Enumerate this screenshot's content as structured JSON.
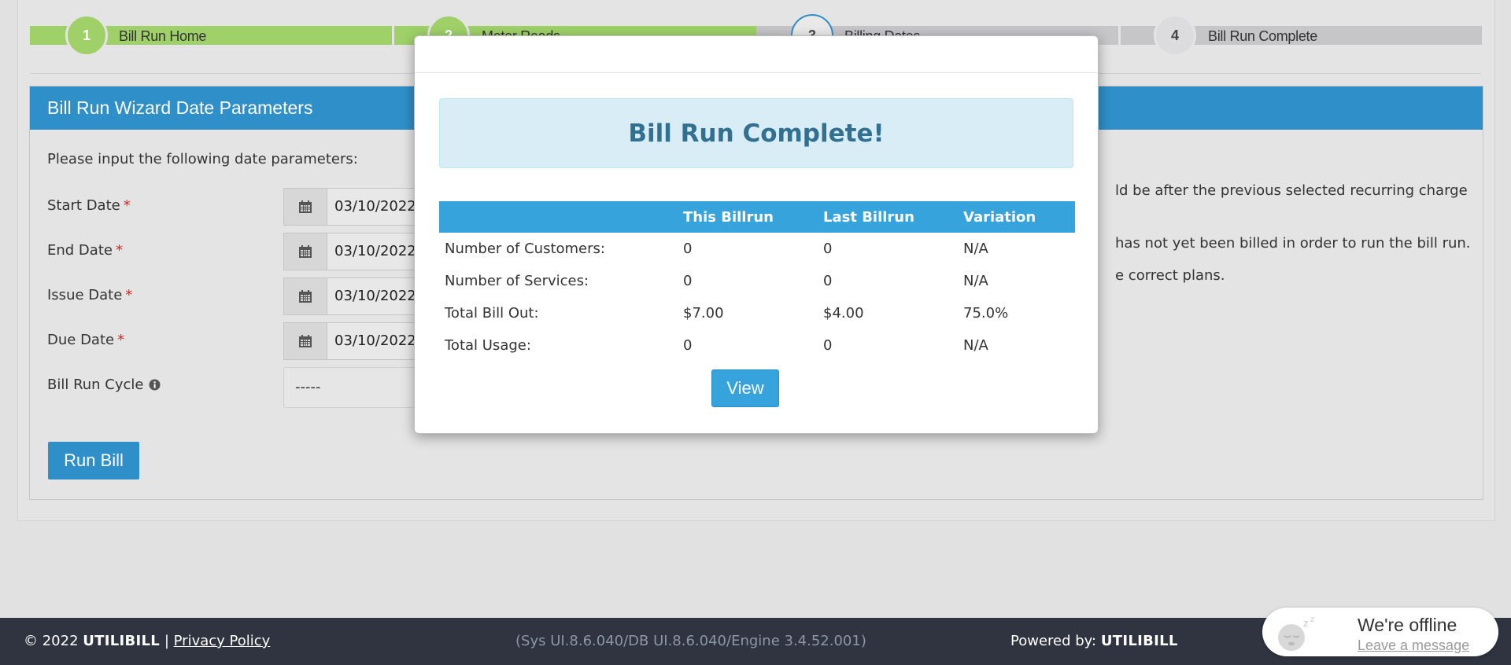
{
  "wizard": {
    "steps": [
      {
        "number": "1",
        "label": "Bill Run Home",
        "state": "done"
      },
      {
        "number": "2",
        "label": "Meter Reads",
        "state": "done"
      },
      {
        "number": "3",
        "label": "Billing Dates",
        "state": "active"
      },
      {
        "number": "4",
        "label": "Bill Run Complete",
        "state": "todo"
      }
    ]
  },
  "card": {
    "title": "Bill Run Wizard Date Parameters",
    "intro": "Please input the following date parameters:",
    "fields": {
      "start_date": {
        "label": "Start Date",
        "value": "03/10/2022"
      },
      "end_date": {
        "label": "End Date",
        "value": "03/10/2022"
      },
      "issue_date": {
        "label": "Issue Date",
        "value": "03/10/2022"
      },
      "due_date": {
        "label": "Due Date",
        "value": "03/10/2022"
      },
      "bill_run_cycle": {
        "label": "Bill Run Cycle",
        "value": "-----"
      }
    },
    "required_marker": "*",
    "run_button": "Run Bill",
    "notes": [
      "ld be after the previous selected recurring charge",
      "has not yet been billed in order to run the bill run.",
      "e correct plans."
    ]
  },
  "modal": {
    "alert": "Bill Run Complete!",
    "table": {
      "headers": [
        "",
        "This Billrun",
        "Last Billrun",
        "Variation"
      ],
      "rows": [
        [
          "Number of Customers:",
          "0",
          "0",
          "N/A"
        ],
        [
          "Number of Services:",
          "0",
          "0",
          "N/A"
        ],
        [
          "Total Bill Out:",
          "$7.00",
          "$4.00",
          "75.0%"
        ],
        [
          "Total Usage:",
          "0",
          "0",
          "N/A"
        ]
      ]
    },
    "view_button": "View"
  },
  "footer": {
    "copyright": "© 2022",
    "brand": "UTILIBILL",
    "separator": "|",
    "privacy_link": "Privacy Policy",
    "version": "(Sys UI.8.6.040/DB UI.8.6.040/Engine 3.4.52.001)",
    "powered_label": "Powered by:",
    "powered_brand": "UTILIBILL"
  },
  "chat": {
    "status": "We're offline",
    "leave_message": "Leave a message",
    "avatar_icon": "sleeping-face-icon"
  },
  "colors": {
    "primary": "#2f8fc8",
    "step_done": "#9fd168",
    "footer_bg": "#2f3440",
    "alert_text": "#31708f"
  }
}
